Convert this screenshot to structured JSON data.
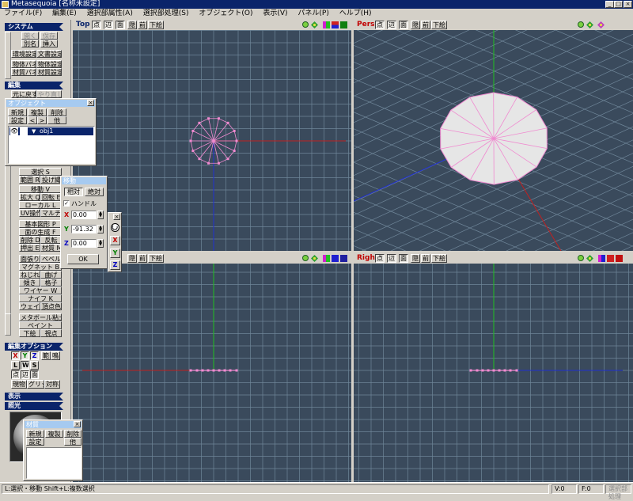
{
  "window": {
    "title": "Metasequoia [名称未設定]",
    "controls": [
      "_",
      "□",
      "×"
    ]
  },
  "menu": [
    "ファイル(F)",
    "編集(E)",
    "選択部属性(A)",
    "選択部処理(S)",
    "オブジェクト(O)",
    "表示(V)",
    "パネル(P)",
    "ヘルプ(H)"
  ],
  "panel": {
    "system": {
      "header": "システム",
      "row1": [
        "開く",
        "保存"
      ],
      "row2": [
        "別名",
        "挿入"
      ],
      "row3": [
        "環境設定",
        "文書設定"
      ],
      "row4": [
        "物体パネル",
        "物体設定"
      ],
      "row5": [
        "材質パネル",
        "材質設定"
      ]
    },
    "edit": {
      "header": "編集",
      "row1": [
        "元に戻す",
        "やり直し"
      ]
    },
    "tools": {
      "select": "選択 S",
      "range_row": [
        "範囲 R",
        "投げ縄"
      ],
      "move": "移動 V",
      "scale_row": [
        "拡大 Q",
        "回転 E"
      ],
      "local": "ローカル L",
      "uv_row": [
        "UV操作 U",
        "マルチ"
      ],
      "primitive": "基本図形 P",
      "face_gen": "面の生成 F",
      "delete_row": [
        "削除 D",
        "反転"
      ],
      "extrude_row": [
        "押出 E",
        "材質 M"
      ],
      "face_row": [
        "面張り",
        "ベベル"
      ],
      "magnet": "マグネット B",
      "twist_row": [
        "ねじれ",
        "曲げ"
      ],
      "lean_row": [
        "傾き",
        "格子"
      ],
      "wire": "ワイヤー W",
      "knife": "ナイフ K",
      "weld_row": [
        "ウェイト",
        "頂点色"
      ],
      "metaball": "メタボール粘土",
      "paint": "ペイント",
      "under_row": [
        "下絵",
        "視点"
      ]
    },
    "editopt": {
      "header": "編集オプション",
      "row1": [
        "X",
        "Y",
        "Z",
        "範",
        "鳴"
      ],
      "row2": [
        "L",
        "W",
        "S"
      ],
      "row3": [
        "点",
        "辺",
        "面"
      ],
      "row4": [
        "現物",
        "グリッド",
        "対称"
      ]
    },
    "display": {
      "header": "表示"
    },
    "light": {
      "header": "照光"
    }
  },
  "object_window": {
    "title": "オブジェクト",
    "row1": [
      "新規",
      "複製",
      "削除"
    ],
    "row2": [
      "設定",
      "<",
      ">",
      "他"
    ],
    "item": "obj1"
  },
  "move_window": {
    "title": "移動",
    "tabs": [
      "相対",
      "絶対"
    ],
    "handle_label": "ハンドル",
    "x_label": "X",
    "y_label": "Y",
    "z_label": "Z",
    "x_value": "0.00",
    "y_value": "-91.32",
    "z_value": "0.00",
    "ok": "OK"
  },
  "axis_window": {
    "buttons": [
      "X",
      "Y",
      "Z"
    ]
  },
  "material_window": {
    "title": "材質",
    "row1": [
      "新規",
      "複製",
      "削除"
    ],
    "row2": [
      "設定",
      "他"
    ]
  },
  "viewports": {
    "top": {
      "name": "Top",
      "buttons": [
        "点",
        "辺",
        "面",
        "隠",
        "前",
        "下絵"
      ]
    },
    "pers": {
      "name": "Pers",
      "buttons": [
        "点",
        "辺",
        "面",
        "隠",
        "前",
        "下絵"
      ]
    },
    "front": {
      "buttons": [
        "隠",
        "前",
        "下絵"
      ]
    },
    "right": {
      "name": "Right",
      "buttons": [
        "点",
        "辺",
        "面",
        "隠",
        "前",
        "下絵"
      ]
    }
  },
  "status": {
    "hint": "L:選択・移動  Shift+L:複数選択",
    "v": "V:0",
    "f": "F:0",
    "mode": "選択部処理"
  },
  "colors": {
    "viewport_bg": "#3a4a5c",
    "grid": "#6f8699",
    "x_axis": "#c02020",
    "y_axis": "#20c020",
    "z_axis": "#2030d0",
    "vertex": "#f08ad0",
    "title_bar": "#0a246a"
  }
}
